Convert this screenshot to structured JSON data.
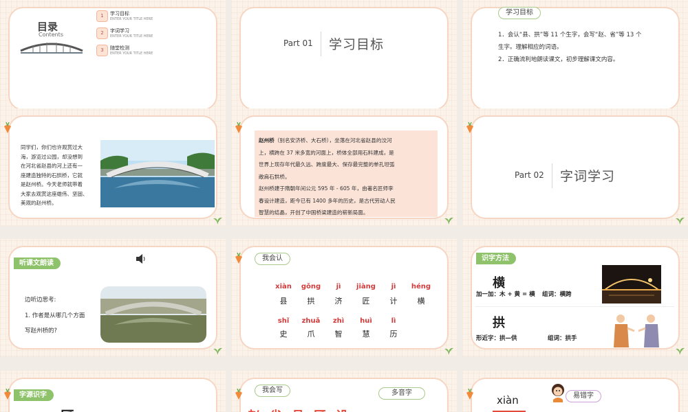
{
  "slides": {
    "s1": {
      "title": "目录",
      "subtitle": "Contents",
      "items": [
        {
          "num": "1",
          "label": "学习目标",
          "sub": "ENTER YOUR TITLE HERE"
        },
        {
          "num": "2",
          "label": "字词学习",
          "sub": "ENTER YOUR TITLE HERE"
        },
        {
          "num": "3",
          "label": "随堂检测",
          "sub": "ENTER YOUR TITLE HERE"
        }
      ]
    },
    "s2": {
      "part": "Part 01",
      "title": "学习目标"
    },
    "s3": {
      "tag": "学习目标",
      "line1": "1．会认“县、拱”等 11 个生字，会写“赵、省”等 13 个",
      "line2": "生字。理解相应的词语。",
      "line3": "2．正确流利地朗读课文，初步理解课文内容。"
    },
    "s4": {
      "lines": [
        "同学们，你们也许观赏过大",
        "海，游览过公园，却没想到",
        "在河北省赵县的河上还有一",
        "座建造独特的石拱桥，它就",
        "是赵州桥。今天老师就带着",
        "大家去观赏这座雄伟、坚固、",
        "美观的赵州桥。"
      ]
    },
    "s5": {
      "bold": "赵州桥",
      "lines": [
        "（别名安济桥、大石桥），坐落在河北省赵县的洨河",
        "上，横跨在 37 米多宽的河面上，桥体全部用石料建成，是",
        "世界上现存年代最久远、跨度最大、保存最完整的单孔坦弧",
        "敞肩石拱桥。",
        "赵州桥建于隋朝年间公元 595 年 - 605 年，由著名匠师李",
        "春设计建造，距今已有 1400 多年的历史，是古代劳动人民",
        "智慧的结晶，开创了中国桥梁建造的崭新局面。"
      ]
    },
    "s6": {
      "part": "Part 02",
      "title": "字词学习"
    },
    "s7": {
      "tag": "听课文朗读",
      "prompt": "边听边思考:",
      "q1": "1. 作者是从哪几个方面",
      "q2": "写赵州桥的?"
    },
    "s8": {
      "tag": "我会认",
      "row1": [
        {
          "py": "xiàn",
          "hz": "县"
        },
        {
          "py": "gǒng",
          "hz": "拱"
        },
        {
          "py": "jì",
          "hz": "济"
        },
        {
          "py": "jiàng",
          "hz": "匠"
        },
        {
          "py": "jì",
          "hz": "计"
        },
        {
          "py": "héng",
          "hz": "横"
        }
      ],
      "row2": [
        {
          "py": "shǐ",
          "hz": "史"
        },
        {
          "py": "zhuǎ",
          "hz": "爪"
        },
        {
          "py": "zhì",
          "hz": "智"
        },
        {
          "py": "huì",
          "hz": "慧"
        },
        {
          "py": "lì",
          "hz": "历"
        }
      ]
    },
    "s9": {
      "tag": "识字方法",
      "char1": "横",
      "line1": "加一加：木 + 黄 = 横",
      "word1": "组词：横跨",
      "char2": "拱",
      "line2": "形近字：拱—供",
      "word2": "组词：拱手"
    },
    "s10": {
      "tag": "字源识字",
      "char": "匠"
    },
    "s11": {
      "tag": "我会写",
      "tag2": "多音字",
      "chars": [
        "赵",
        "省",
        "县",
        "匠",
        "设"
      ]
    },
    "s12": {
      "pinyin": "xiàn",
      "tag": "易错字"
    }
  },
  "colors": {
    "frame_border": "#f6d6c3",
    "tag_green": "#8fc36b",
    "pinyin_red": "#d13b3b",
    "highlight_bg": "#fbe3d8"
  }
}
